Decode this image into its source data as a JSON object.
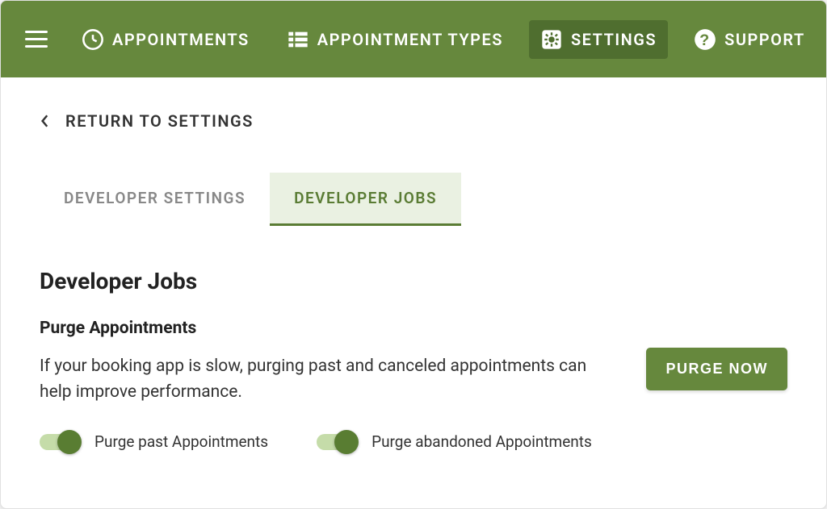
{
  "nav": {
    "items": [
      {
        "label": "APPOINTMENTS"
      },
      {
        "label": "APPOINTMENT TYPES"
      },
      {
        "label": "SETTINGS"
      },
      {
        "label": "SUPPORT"
      }
    ]
  },
  "return_label": "RETURN TO SETTINGS",
  "tabs": [
    {
      "label": "DEVELOPER SETTINGS"
    },
    {
      "label": "DEVELOPER JOBS"
    }
  ],
  "section": {
    "title": "Developer Jobs",
    "subheading": "Purge Appointments",
    "description": "If your booking app is slow, purging past and canceled appointments can help improve performance.",
    "button": "PURGE NOW",
    "toggles": [
      {
        "label": "Purge past Appointments"
      },
      {
        "label": "Purge abandoned Appointments"
      }
    ]
  }
}
